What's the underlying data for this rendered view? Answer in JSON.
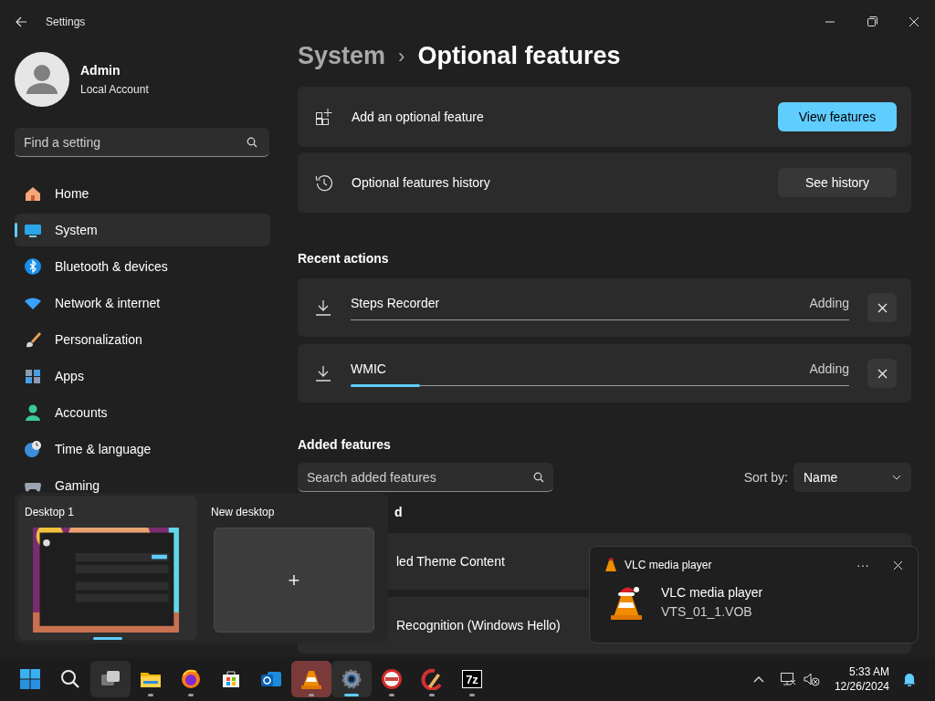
{
  "window": {
    "title": "Settings"
  },
  "profile": {
    "name": "Admin",
    "account": "Local Account"
  },
  "sidebar": {
    "search": {
      "placeholder": "Find a setting"
    },
    "items": [
      {
        "kind": "home",
        "label": "Home",
        "selected": false
      },
      {
        "kind": "system",
        "label": "System",
        "selected": true
      },
      {
        "kind": "bluetooth",
        "label": "Bluetooth & devices",
        "selected": false
      },
      {
        "kind": "network",
        "label": "Network & internet",
        "selected": false
      },
      {
        "kind": "brush",
        "label": "Personalization",
        "selected": false
      },
      {
        "kind": "apps",
        "label": "Apps",
        "selected": false
      },
      {
        "kind": "accounts",
        "label": "Accounts",
        "selected": false
      },
      {
        "kind": "time",
        "label": "Time & language",
        "selected": false
      },
      {
        "kind": "gaming",
        "label": "Gaming",
        "selected": false
      }
    ]
  },
  "breadcrumb": {
    "parent": "System",
    "separator": "›",
    "current": "Optional features"
  },
  "cards": [
    {
      "kind": "add",
      "label": "Add an optional feature",
      "button": "View features",
      "primary": true
    },
    {
      "kind": "history",
      "label": "Optional features history",
      "button": "See history",
      "primary": false
    }
  ],
  "recent_actions": {
    "heading": "Recent actions",
    "items": [
      {
        "name": "Steps Recorder",
        "status": "Adding",
        "level": 0
      },
      {
        "name": "WMIC",
        "status": "Adding",
        "level": 0.14
      }
    ]
  },
  "added_features": {
    "heading": "Added features",
    "search": {
      "placeholder": "Search added features"
    },
    "sort_label": "Sort by:",
    "sort_value": "Name",
    "subheading": "d",
    "rows": [
      "led Theme Content",
      "Recognition (Windows Hello)"
    ]
  },
  "desktops": [
    {
      "label": "Desktop 1",
      "kind": "thumbnail",
      "selected": true
    },
    {
      "label": "New desktop",
      "kind": "new",
      "selected": false
    }
  ],
  "desktop_new_symbol": "+",
  "toast": {
    "app": "VLC media player",
    "more": "···",
    "title": "VLC media player",
    "body": "VTS_01_1.VOB"
  },
  "taskbar": {
    "items": [
      {
        "kind": "start",
        "running": false,
        "flashing": false,
        "selected": false
      },
      {
        "kind": "search",
        "running": false,
        "flashing": false,
        "selected": false
      },
      {
        "kind": "taskview",
        "running": false,
        "flashing": false,
        "selected": true
      },
      {
        "kind": "explorer",
        "running": true,
        "flashing": false,
        "selected": false
      },
      {
        "kind": "firefox",
        "running": true,
        "flashing": false,
        "selected": false
      },
      {
        "kind": "store",
        "running": false,
        "flashing": false,
        "selected": false
      },
      {
        "kind": "outlook",
        "running": false,
        "flashing": false,
        "selected": false
      },
      {
        "kind": "vlc",
        "running": true,
        "flashing": true,
        "selected": false
      },
      {
        "kind": "settings",
        "running": true,
        "flashing": false,
        "selected": true
      },
      {
        "kind": "redcircle",
        "running": true,
        "flashing": false,
        "selected": false
      },
      {
        "kind": "ccleaner",
        "running": true,
        "flashing": false,
        "selected": false
      },
      {
        "kind": "sevenzip",
        "label": "7z",
        "running": true,
        "flashing": false,
        "selected": false
      }
    ],
    "time": "5:33 AM",
    "date": "12/26/2024"
  }
}
